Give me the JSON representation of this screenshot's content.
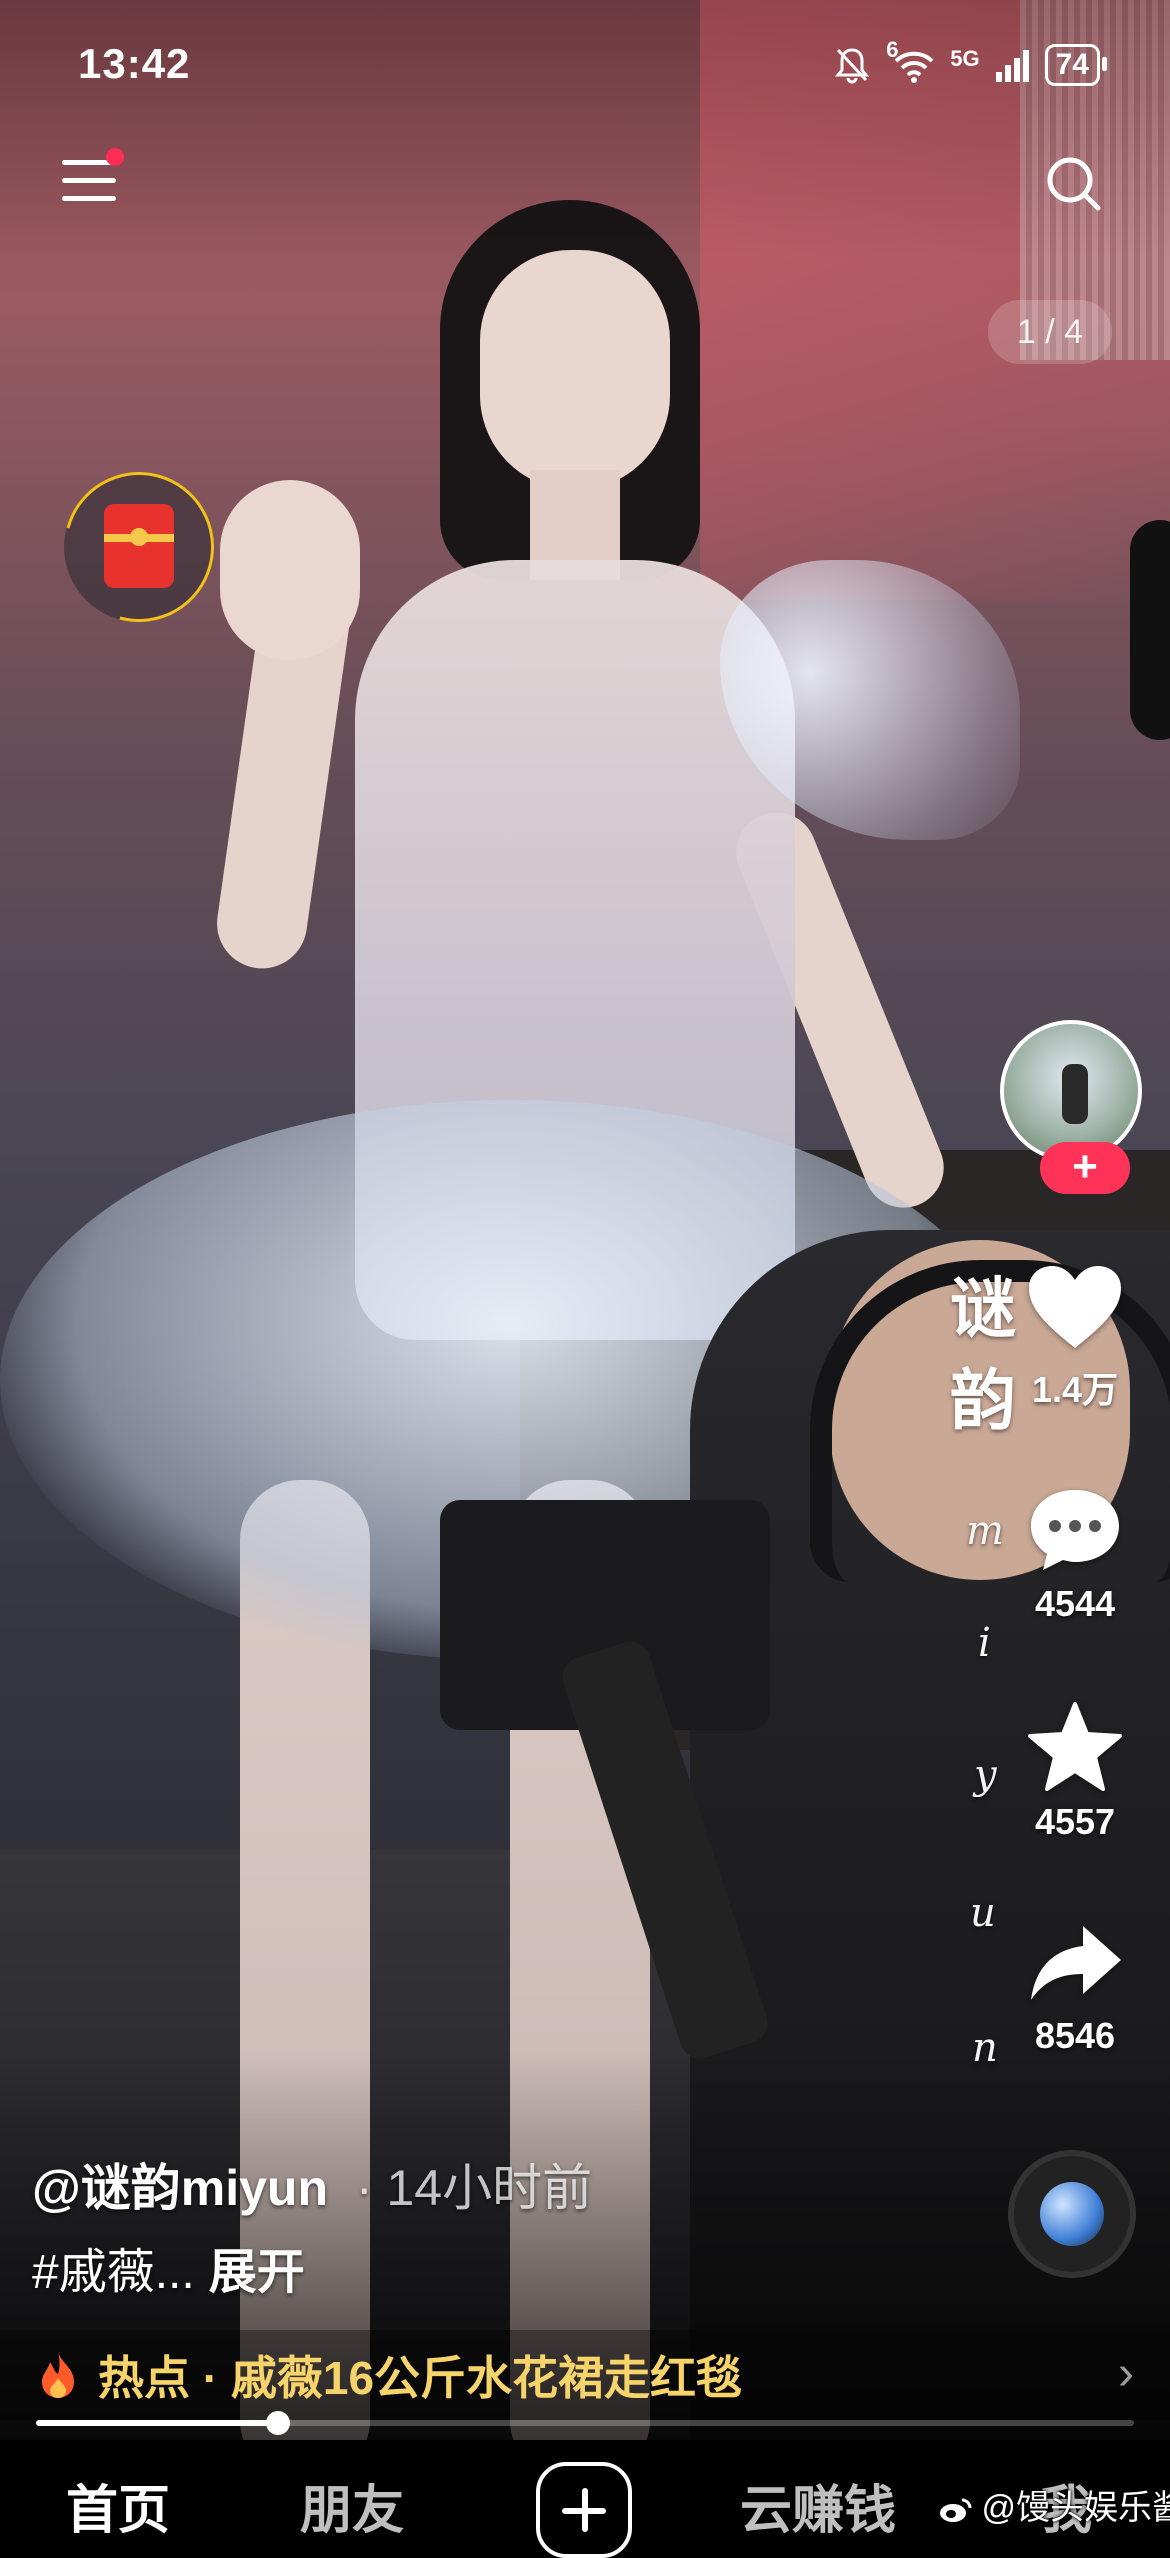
{
  "status_bar": {
    "time": "13:42",
    "network_label": "5G",
    "wifi_sub": "6",
    "battery": "74"
  },
  "top_bar": {
    "page_counter": "1 / 4",
    "menu_has_badge": true
  },
  "side_actions": {
    "author_vertical": [
      "谜",
      "韵"
    ],
    "author_script": [
      "m",
      "i",
      "y",
      "u",
      "n"
    ],
    "follow_label": "+",
    "likes": "1.4万",
    "comments": "4544",
    "favorites": "4557",
    "shares": "8546"
  },
  "post": {
    "author": "@谜韵miyun",
    "time_sep": "·",
    "time": "14小时前",
    "caption": "#戚薇...",
    "expand": "展开"
  },
  "hot": {
    "label": "热点 · 戚薇16公斤水花裙走红毯",
    "chevron": "›"
  },
  "playback": {
    "progress_fraction": 0.22
  },
  "tabs": {
    "home": "首页",
    "friends": "朋友",
    "earn": "云赚钱",
    "me": "我"
  },
  "watermark": "@馒头娱乐酱",
  "colors": {
    "accent_red": "#ff3358",
    "hot_text": "#f6d36b",
    "ring_yellow": "#f2c11a"
  }
}
